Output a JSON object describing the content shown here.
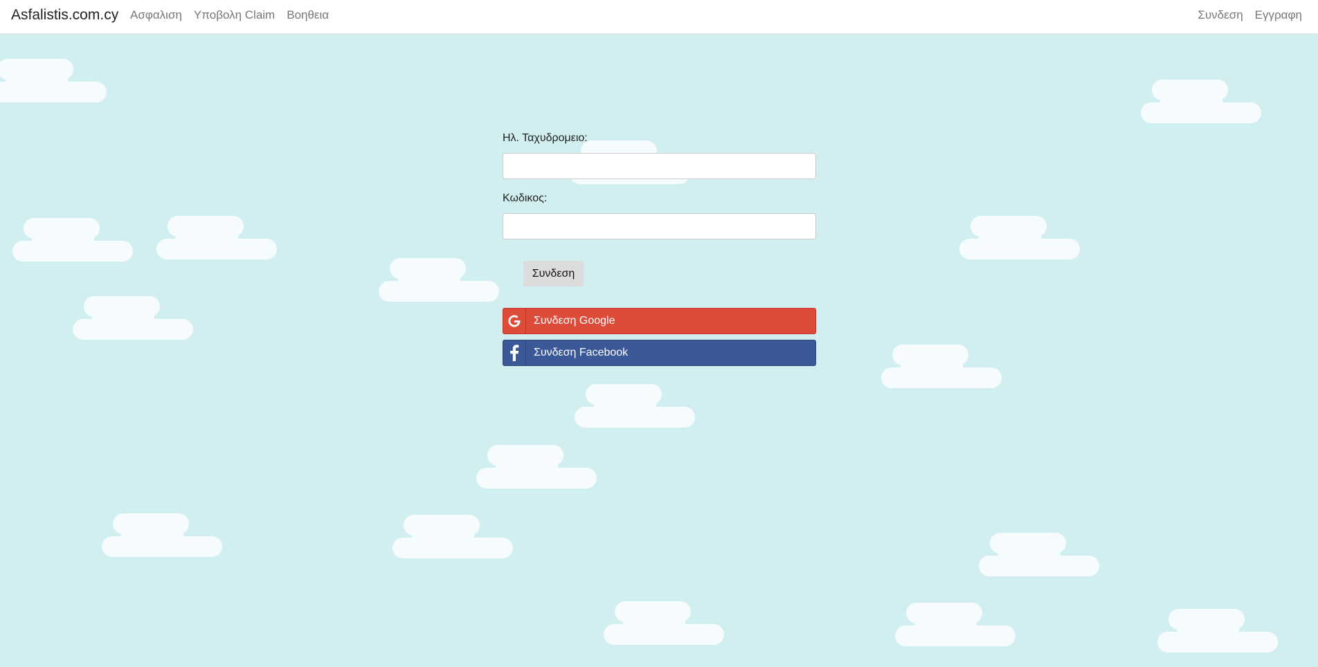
{
  "navbar": {
    "brand": "Asfalistis.com.cy",
    "left_links": [
      "Ασφαλιση",
      "Υποβολη Claim",
      "Βοηθεια"
    ],
    "right_links": [
      "Συνδεση",
      "Εγγραφη"
    ]
  },
  "login_form": {
    "email_label": "Ηλ. Ταχυδρομειο:",
    "email_value": "",
    "password_label": "Κωδικος:",
    "password_value": "",
    "submit_label": "Συνδεση",
    "google_label": "Συνδεση Google",
    "facebook_label": "Συνδεση Facebook"
  },
  "colors": {
    "background": "#d1eef0",
    "cloud": "#f6fcfd",
    "google": "#dd4b39",
    "facebook": "#3b5998"
  },
  "icons": {
    "google": "google-icon",
    "facebook": "facebook-icon"
  }
}
